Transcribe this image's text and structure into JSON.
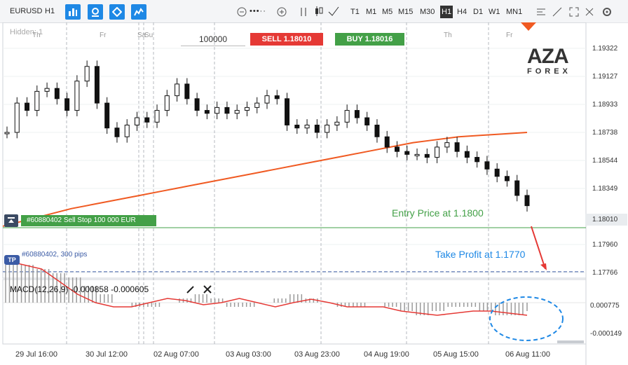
{
  "toolbar": {
    "symbol": "EURUSD",
    "timeframe": "H1",
    "timeframes": [
      "T1",
      "M1",
      "M5",
      "M15",
      "M30",
      "H1",
      "H4",
      "D1",
      "W1",
      "MN1"
    ],
    "active_timeframe": "H1",
    "zoom_dots": "•••··"
  },
  "order": {
    "quantity": "100000",
    "sell_label": "SELL 1.18010",
    "buy_label": "BUY 1.18016"
  },
  "hidden_label": "Hidden: 1",
  "position": {
    "sl_label": "#60880402 Sell Stop 100 000 EUR",
    "tp_label": "#60880402, 300 pips",
    "tp_badge": "TP",
    "entry_annotation": "Entry Price at 1.1800",
    "tp_annotation": "Take Profit at 1.1770",
    "current_price": "1.18010"
  },
  "macd": {
    "title": "MACD(12,26,9) -0.000858 -0.000605",
    "scale": [
      "0.000775",
      "-0.000149"
    ]
  },
  "logo": {
    "brand": "AZA",
    "sub": "FOREX"
  },
  "chart_data": {
    "type": "line",
    "price_scale": [
      "1.19322",
      "1.19127",
      "1.18933",
      "1.18738",
      "1.18544",
      "1.18349",
      "1.18010",
      "1.17960",
      "1.17766"
    ],
    "x_labels": [
      "29 Jul 16:00",
      "30 Jul 12:00",
      "02 Aug 07:00",
      "03 Aug 03:00",
      "03 Aug 23:00",
      "04 Aug 19:00",
      "05 Aug 15:00",
      "06 Aug 11:00"
    ],
    "day_labels": [
      "Th",
      "Fr",
      "Sa",
      "Su",
      "Th",
      "Fr"
    ],
    "entry_price": 1.18,
    "take_profit": 1.177,
    "ylim": [
      1.1768,
      1.194
    ],
    "series": [
      {
        "name": "close",
        "color": "#111111",
        "values": [
          1.1865,
          1.1885,
          1.188,
          1.1893,
          1.1895,
          1.1888,
          1.188,
          1.19,
          1.191,
          1.1885,
          1.1868,
          1.1862,
          1.187,
          1.1875,
          1.1872,
          1.188,
          1.189,
          1.1898,
          1.1888,
          1.188,
          1.1878,
          1.1882,
          1.1878,
          1.188,
          1.1882,
          1.1885,
          1.189,
          1.1888,
          1.187,
          1.1868,
          1.187,
          1.1865,
          1.187,
          1.1872,
          1.188,
          1.1875,
          1.187,
          1.1862,
          1.1855,
          1.1852,
          1.185,
          1.185,
          1.1848,
          1.1855,
          1.1858,
          1.1852,
          1.1848,
          1.1845,
          1.184,
          1.1835,
          1.1832,
          1.1822,
          1.1815
        ]
      },
      {
        "name": "ma",
        "color": "#f05a22",
        "values": [
          1.1801,
          1.1805,
          1.1809,
          1.1813,
          1.1816,
          1.1819,
          1.1822,
          1.1825,
          1.1828,
          1.1831,
          1.1834,
          1.1837,
          1.184,
          1.1843,
          1.1846,
          1.1849,
          1.1852,
          1.1855,
          1.1858,
          1.186,
          1.1862,
          1.1863,
          1.1864,
          1.1865
        ]
      }
    ],
    "macd_histogram": [
      0.0009,
      0.0009,
      0.0008,
      0.0007,
      0.0006,
      0.0004,
      0.0002,
      0.0,
      -0.0001,
      -0.0001,
      0.0,
      0.0001,
      0.0002,
      0.0001,
      -0.0001,
      -0.0001,
      0.0,
      0.0001,
      0.0002,
      0.0001,
      0.0,
      -0.0001,
      -0.0001,
      0.0,
      -0.0001,
      -0.0002,
      -0.0003,
      -0.0002,
      -0.0001,
      -0.0001,
      -0.0002,
      -0.0003,
      -0.0003,
      -0.0002
    ],
    "macd_signal": [
      0.001,
      0.0009,
      0.0008,
      0.0005,
      0.0002,
      0.0,
      -0.0001,
      -0.0001,
      0.0,
      0.0001,
      5e-05,
      -5e-05,
      0.0,
      0.0001,
      0.0,
      -0.0001,
      0.0,
      8e-05,
      0.0,
      -0.0001,
      -0.0001,
      -0.0001,
      -0.0002,
      -0.00025,
      -0.0003,
      -0.00025,
      -0.0002,
      -0.0002,
      -0.00025,
      -0.0003
    ]
  }
}
